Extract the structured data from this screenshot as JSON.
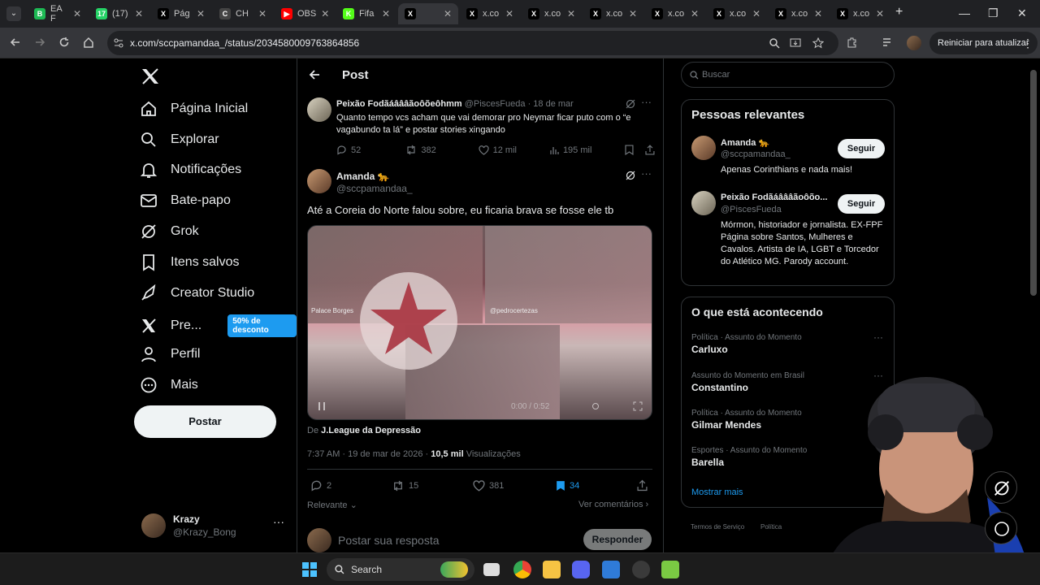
{
  "browser": {
    "tabs": [
      {
        "label": "EA F",
        "fav": "B",
        "color": "#1db954"
      },
      {
        "label": "(17)",
        "fav": "17",
        "color": "#25d366"
      },
      {
        "label": "Pág",
        "fav": "X",
        "color": "#000000"
      },
      {
        "label": "CH",
        "fav": "C",
        "color": "#444444"
      },
      {
        "label": "OBS",
        "fav": "▶",
        "color": "#ff0000"
      },
      {
        "label": "Fifa",
        "fav": "K",
        "color": "#53fc18"
      },
      {
        "label": "",
        "fav": "X",
        "color": "#000000",
        "active": true
      },
      {
        "label": "x.co",
        "fav": "X",
        "color": "#000000"
      },
      {
        "label": "x.co",
        "fav": "X",
        "color": "#000000"
      },
      {
        "label": "x.co",
        "fav": "X",
        "color": "#000000"
      },
      {
        "label": "x.co",
        "fav": "X",
        "color": "#000000"
      },
      {
        "label": "x.co",
        "fav": "X",
        "color": "#000000"
      },
      {
        "label": "x.co",
        "fav": "X",
        "color": "#000000"
      },
      {
        "label": "x.co",
        "fav": "X",
        "color": "#000000"
      }
    ],
    "url": "x.com/sccpamandaa_/status/2034580009763864856",
    "restart_label": "Reiniciar para atualizar"
  },
  "nav": {
    "items": [
      {
        "label": "Página Inicial",
        "icon": "home-icon"
      },
      {
        "label": "Explorar",
        "icon": "search-icon"
      },
      {
        "label": "Notificações",
        "icon": "bell-icon"
      },
      {
        "label": "Bate-papo",
        "icon": "mail-icon"
      },
      {
        "label": "Grok",
        "icon": "grok-icon"
      },
      {
        "label": "Itens salvos",
        "icon": "bookmark-icon"
      },
      {
        "label": "Creator Studio",
        "icon": "rocket-icon"
      },
      {
        "label": "Pre...",
        "icon": "x-logo-icon"
      },
      {
        "label": "Perfil",
        "icon": "person-icon"
      },
      {
        "label": "Mais",
        "icon": "more-circle-icon"
      }
    ],
    "promo_badge": "50% de desconto",
    "post_button": "Postar",
    "account": {
      "name": "Krazy",
      "handle": "@Krazy_Bong"
    }
  },
  "post": {
    "header_title": "Post",
    "quoted": {
      "author": "Peixão Fodãáâââãoôõeôhmm",
      "handle": "@PiscesFueda",
      "date": "· 18 de mar",
      "text": "Quanto tempo vcs acham que vai demorar pro Neymar ficar puto com o “e vagabundo ta lá” e postar stories xingando",
      "replies": "52",
      "reposts": "382",
      "likes": "12 mil",
      "views": "195 mil"
    },
    "main": {
      "author": "Amanda 🐆",
      "handle": "@sccpamandaa_",
      "text": "Até a Coreia do Norte falou sobre, eu ficaria brava se fosse ele tb",
      "video_label_left": "Palace Borges",
      "video_label_right": "@pedrocertezas",
      "video_time": "0:00 / 0:52",
      "source_prefix": "De",
      "source": "J.League da Depressão",
      "timestamp": "7:37 AM · 19 de mar de 2026 ·",
      "views_count": "10,5 mil",
      "views_label": "Visualizações",
      "replies": "2",
      "reposts": "15",
      "likes": "381",
      "bookmarks": "34",
      "sort_label": "Relevante",
      "see_comments": "Ver comentários",
      "reply_placeholder": "Postar sua resposta",
      "reply_button": "Responder"
    }
  },
  "sidebar": {
    "search_placeholder": "Buscar",
    "people_title": "Pessoas relevantes",
    "people": [
      {
        "name": "Amanda 🐆",
        "handle": "@sccpamandaa_",
        "bio": "Apenas Corinthians e nada mais!",
        "follow": "Seguir"
      },
      {
        "name": "Peixão Fodãáâââãoôõo...",
        "handle": "@PiscesFueda",
        "bio": "Mórmon, historiador e jornalista. EX-FPF Página sobre Santos, Mulheres e Cavalos. Artista de IA, LGBT e Torcedor do Atlético MG. Parody account.",
        "follow": "Seguir"
      }
    ],
    "trends_title": "O que está acontecendo",
    "trends": [
      {
        "context": "Política · Assunto do Momento",
        "name": "Carluxo"
      },
      {
        "context": "Assunto do Momento em Brasil",
        "name": "Constantino"
      },
      {
        "context": "Política · Assunto do Momento",
        "name": "Gilmar Mendes"
      },
      {
        "context": "Esportes · Assunto do Momento",
        "name": "Barella"
      }
    ],
    "show_more": "Mostrar mais",
    "footer1": "Termos de Serviço",
    "footer2": "Política"
  },
  "taskbar": {
    "search": "Search"
  },
  "colors": {
    "accent": "#1d9bf0",
    "bg": "#000000",
    "border": "#2f3336",
    "muted": "#71767b"
  }
}
